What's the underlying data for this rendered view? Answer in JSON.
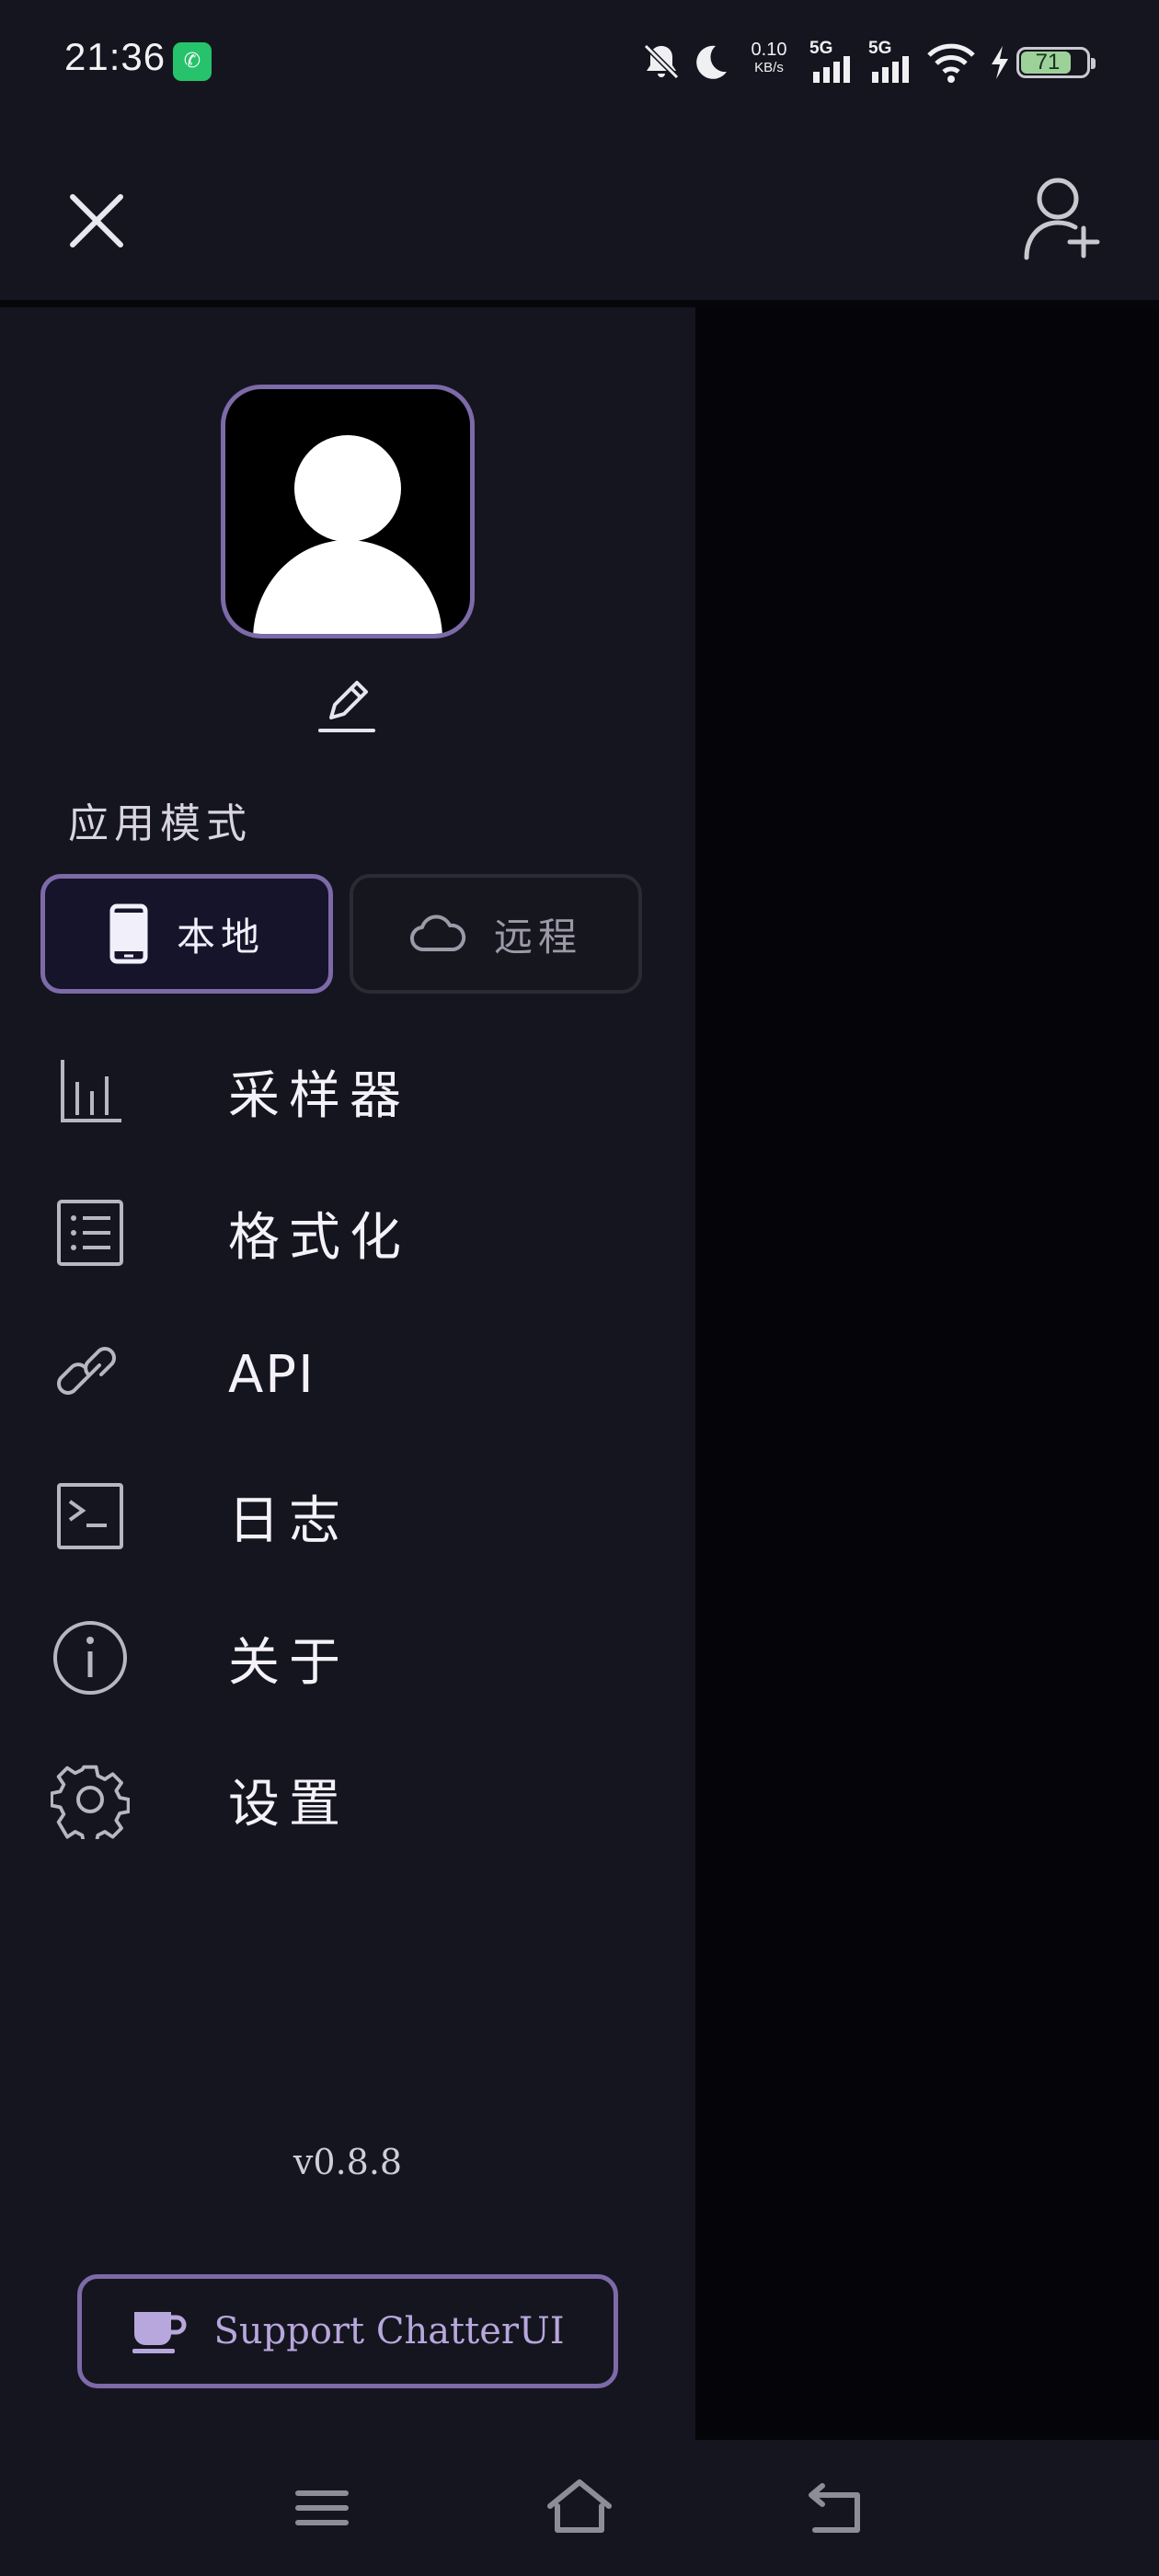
{
  "status_bar": {
    "time": "21:36",
    "app_icon": "phone-app-icon",
    "net_speed_value": "0.10",
    "net_speed_unit": "KB/s",
    "sim1": "5G",
    "sim2": "5G",
    "battery_level": "71",
    "icons": [
      "bell-muted-icon",
      "moon-icon",
      "signal-icon",
      "wifi-icon",
      "charging-icon",
      "battery-icon"
    ]
  },
  "header": {
    "close_icon": "close-icon",
    "add_user_icon": "add-user-icon"
  },
  "drawer": {
    "mode_label": "应用模式",
    "modes": [
      {
        "label": "本地",
        "icon": "phone-icon",
        "selected": true
      },
      {
        "label": "远程",
        "icon": "cloud-icon",
        "selected": false
      }
    ],
    "menu": [
      {
        "label": "采样器",
        "icon": "bar-chart-icon"
      },
      {
        "label": "格式化",
        "icon": "list-icon"
      },
      {
        "label": "API",
        "icon": "link-icon"
      },
      {
        "label": "日志",
        "icon": "terminal-icon"
      },
      {
        "label": "关于",
        "icon": "info-icon"
      },
      {
        "label": "设置",
        "icon": "gear-icon"
      }
    ],
    "version": "v0.8.8",
    "support_label": "Support ChatterUI"
  },
  "nav_bar": {
    "icons": [
      "menu-icon",
      "home-icon",
      "back-icon"
    ]
  },
  "colors": {
    "accent": "#7d6aa8",
    "drawer_bg": "#15151f",
    "backdrop": "#050408",
    "support_text": "#b7a7dc"
  }
}
